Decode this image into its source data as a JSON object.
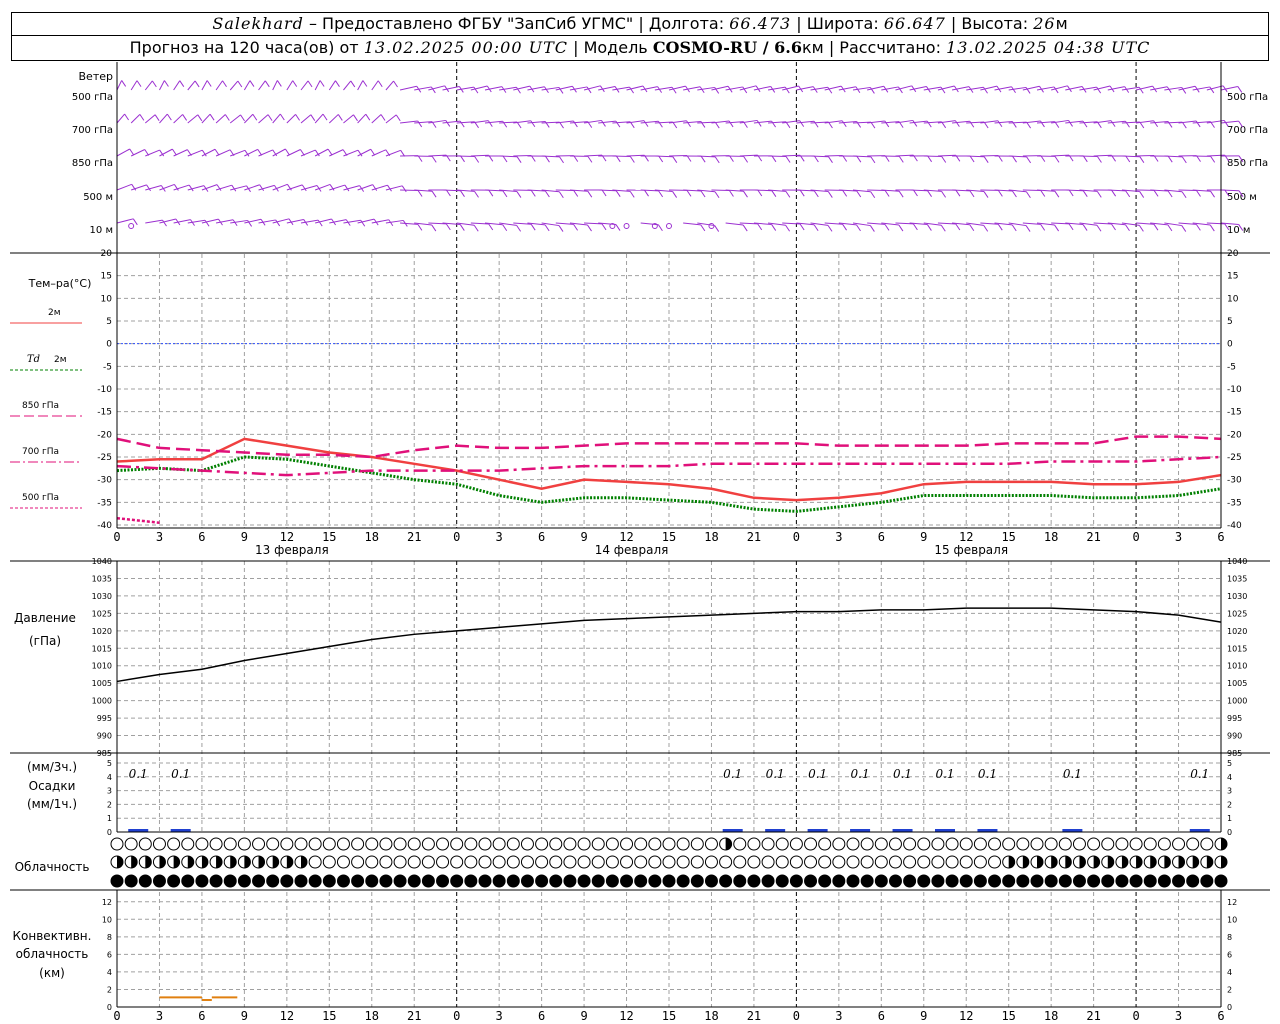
{
  "header": {
    "station": "Salekhard",
    "provided_by": "– Предоставлено ФГБУ \"ЗапСиб УГМС\"",
    "lon_label": "Долгота:",
    "lon": "66.473",
    "lat_label": "Широта:",
    "lat": "66.647",
    "alt_label": "Высота:",
    "alt": "26",
    "alt_unit": "м",
    "forecast_label": "Прогноз на 120 часа(ов) от",
    "forecast_time": "13.02.2025 00:00 UTC",
    "model_label": "Модель",
    "model": "COSMO-RU / 6.6",
    "model_unit": "км",
    "computed_label": "Рассчитано:",
    "computed": "13.02.2025 04:38 UTC",
    "sep": "|"
  },
  "labels": {
    "wind": "Ветер",
    "wind_levels": [
      "500 гПа",
      "700 гПа",
      "850 гПа",
      "500 м",
      "10 м"
    ],
    "temp_title": "Тем–ра(°С)",
    "temp_2m": "2м",
    "td_prefix": "Td",
    "td_suffix": "2м",
    "t850": "850 гПа",
    "t700": "700 гПа",
    "t500": "500 гПа",
    "pressure_title": "Давление",
    "pressure_unit": "(гПа)",
    "precip_unit3": "(мм/3ч.)",
    "precip_title": "Осадки",
    "precip_unit1": "(мм/1ч.)",
    "cloud_title": "Облачность",
    "conv_title1": "Конвективн.",
    "conv_title2": "облачность",
    "conv_unit": "(км)"
  },
  "x_ticks": [
    "0",
    "3",
    "6",
    "9",
    "12",
    "15",
    "18",
    "21",
    "0",
    "3",
    "6",
    "9",
    "12",
    "15",
    "18",
    "21",
    "0",
    "3",
    "6",
    "9",
    "12",
    "15",
    "18",
    "21",
    "0",
    "3",
    "6"
  ],
  "dates": [
    "13 февраля",
    "14 февраля",
    "15 февраля"
  ],
  "colors": {
    "wind": "#9b30d0",
    "t2m": "#f04040",
    "td": "#008000",
    "t850": "#e0107a",
    "zero": "#3050ff",
    "precip": "#2040d0",
    "conv": "#e08010",
    "grid": "#a0a0a0"
  },
  "chart_data": [
    {
      "type": "line",
      "name": "temperature",
      "x_hours": [
        0,
        3,
        6,
        9,
        12,
        15,
        18,
        21,
        24,
        27,
        30,
        33,
        36,
        39,
        42,
        45,
        48,
        51,
        54,
        57,
        60,
        63,
        66,
        69,
        72,
        75,
        78
      ],
      "ylim": [
        -40,
        20
      ],
      "yticks": [
        20,
        15,
        10,
        5,
        0,
        -5,
        -10,
        -15,
        -20,
        -25,
        -30,
        -35,
        -40
      ],
      "zero_line": 0,
      "series": [
        {
          "name": "2м",
          "style": "solid",
          "values": [
            -26,
            -25.5,
            -25.5,
            -21,
            -22.5,
            -24,
            -25,
            -26.5,
            -28,
            -30,
            -32,
            -30,
            -30.5,
            -31,
            -32,
            -34,
            -34.5,
            -34,
            -33,
            -31,
            -30.5,
            -30.5,
            -30.5,
            -31,
            -31,
            -30.5,
            -29
          ]
        },
        {
          "name": "Td 2м",
          "style": "dotted",
          "values": [
            -28,
            -27.5,
            -28,
            -25,
            -25.5,
            -27,
            -28.5,
            -30,
            -31,
            -33.5,
            -35,
            -34,
            -34,
            -34.5,
            -35,
            -36.5,
            -37,
            -36,
            -35,
            -33.5,
            -33.5,
            -33.5,
            -33.5,
            -34,
            -34,
            -33.5,
            -32
          ]
        },
        {
          "name": "850 гПа",
          "style": "dashed",
          "values": [
            -21,
            -23,
            -23.5,
            -24,
            -24.5,
            -24.5,
            -25,
            -23.5,
            -22.5,
            -23,
            -23,
            -22.5,
            -22,
            -22,
            -22,
            -22,
            -22,
            -22.5,
            -22.5,
            -22.5,
            -22.5,
            -22,
            -22,
            -22,
            -20.5,
            -20.5,
            -21
          ]
        },
        {
          "name": "700 гПа",
          "style": "dashdot",
          "values": [
            -27,
            -27.5,
            -28,
            -28.5,
            -29,
            -28.5,
            -28,
            -28,
            -28,
            -28,
            -27.5,
            -27,
            -27,
            -27,
            -26.5,
            -26.5,
            -26.5,
            -26.5,
            -26.5,
            -26.5,
            -26.5,
            -26.5,
            -26,
            -26,
            -26,
            -25.5,
            -25
          ]
        },
        {
          "name": "500 гПа",
          "style": "dashed-short",
          "values": [
            -38.5,
            -39.5
          ]
        }
      ]
    },
    {
      "type": "line",
      "name": "pressure",
      "x_hours": [
        0,
        3,
        6,
        9,
        12,
        15,
        18,
        21,
        24,
        27,
        30,
        33,
        36,
        39,
        42,
        45,
        48,
        51,
        54,
        57,
        60,
        63,
        66,
        69,
        72,
        75,
        78
      ],
      "ylim": [
        985,
        1040
      ],
      "yticks": [
        1040,
        1035,
        1030,
        1025,
        1020,
        1015,
        1010,
        1005,
        1000,
        995,
        990,
        985
      ],
      "values": [
        1005.5,
        1007.5,
        1009,
        1011.5,
        1013.5,
        1015.5,
        1017.5,
        1019,
        1020,
        1021,
        1022,
        1023,
        1023.5,
        1024,
        1024.5,
        1025,
        1025.5,
        1025.5,
        1026,
        1026,
        1026.5,
        1026.5,
        1026.5,
        1026,
        1025.5,
        1024.5,
        1022.5
      ]
    },
    {
      "type": "bar",
      "name": "precipitation",
      "ylim": [
        0,
        5
      ],
      "yticks": [
        5,
        4,
        3,
        2,
        1,
        0
      ],
      "labels": [
        {
          "hour": 1.5,
          "text": "0.1"
        },
        {
          "hour": 4.5,
          "text": "0.1"
        },
        {
          "hour": 43.5,
          "text": "0.1"
        },
        {
          "hour": 46.5,
          "text": "0.1"
        },
        {
          "hour": 49.5,
          "text": "0.1"
        },
        {
          "hour": 52.5,
          "text": "0.1"
        },
        {
          "hour": 55.5,
          "text": "0.1"
        },
        {
          "hour": 58.5,
          "text": "0.1"
        },
        {
          "hour": 61.5,
          "text": "0.1"
        },
        {
          "hour": 67.5,
          "text": "0.1"
        },
        {
          "hour": 76.5,
          "text": "0.1"
        }
      ]
    },
    {
      "type": "line",
      "name": "convective_cloud",
      "ylim": [
        0,
        13
      ],
      "yticks": [
        12,
        10,
        8,
        6,
        4,
        2,
        0
      ],
      "segments": [
        [
          3,
          6,
          1.1
        ],
        [
          6,
          6.7,
          0.8
        ],
        [
          6.7,
          8.5,
          1.1
        ]
      ]
    }
  ]
}
